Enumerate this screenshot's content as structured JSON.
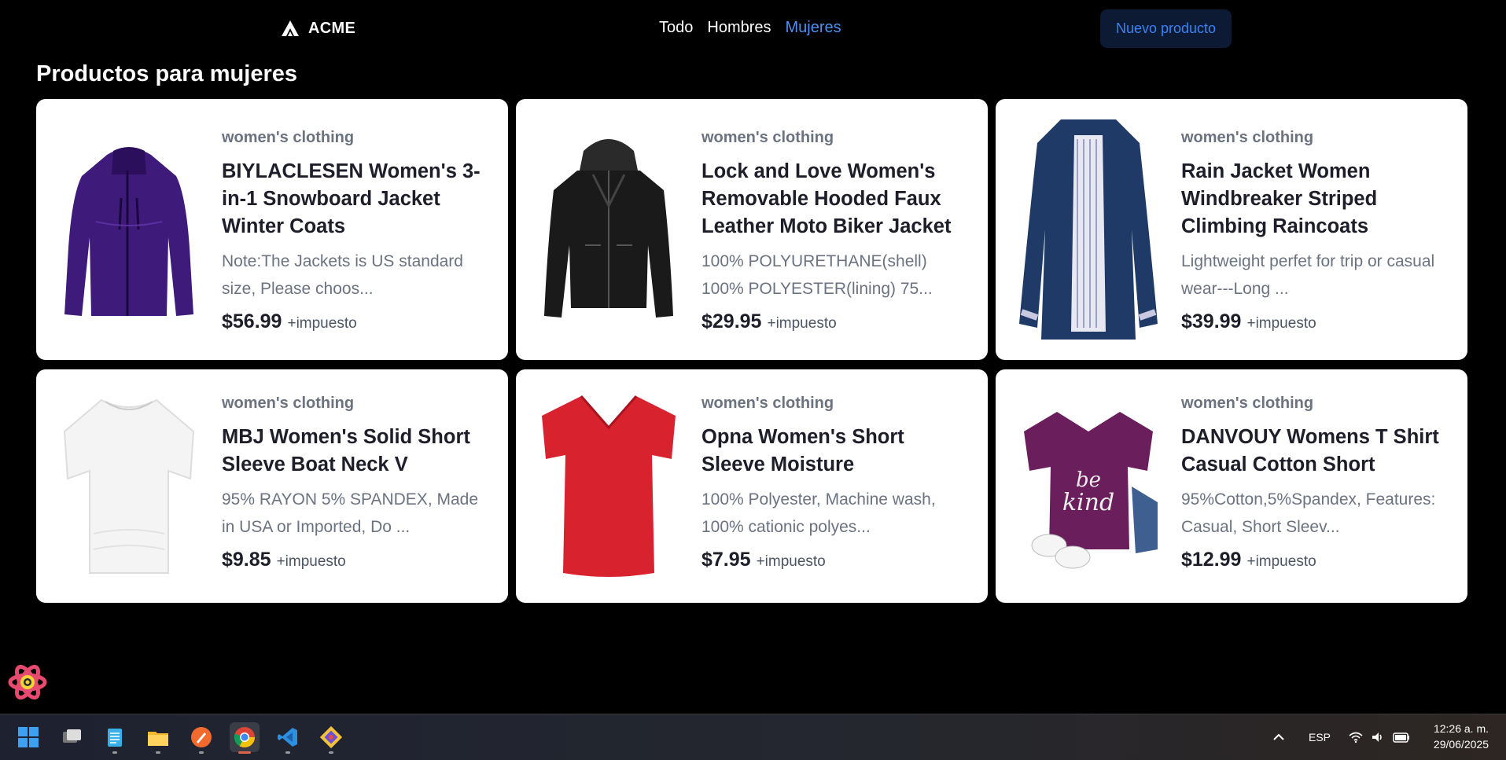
{
  "header": {
    "logo_text": "ACME",
    "nav": [
      {
        "label": "Todo",
        "active": false
      },
      {
        "label": "Hombres",
        "active": false
      },
      {
        "label": "Mujeres",
        "active": true
      }
    ],
    "new_product_label": "Nuevo producto"
  },
  "page_title": "Productos para mujeres",
  "products": [
    {
      "category": "women's clothing",
      "title": "BIYLACLESEN Women's 3-in-1 Snowboard Jacket Winter Coats",
      "description": "Note:The Jackets is US standard size, Please choos...",
      "price": "$56.99",
      "tax": "+impuesto",
      "image_icon": "purple-jacket-icon"
    },
    {
      "category": "women's clothing",
      "title": "Lock and Love Women's Removable Hooded Faux Leather Moto Biker Jacket",
      "description": "100% POLYURETHANE(shell) 100% POLYESTER(lining) 75...",
      "price": "$29.95",
      "tax": "+impuesto",
      "image_icon": "black-leather-jacket-icon"
    },
    {
      "category": "women's clothing",
      "title": "Rain Jacket Women Windbreaker Striped Climbing Raincoats",
      "description": "Lightweight perfet for trip or casual wear---Long ...",
      "price": "$39.99",
      "tax": "+impuesto",
      "image_icon": "navy-raincoat-icon"
    },
    {
      "category": "women's clothing",
      "title": "MBJ Women's Solid Short Sleeve Boat Neck V",
      "description": "95% RAYON 5% SPANDEX, Made in USA or Imported, Do ...",
      "price": "$9.85",
      "tax": "+impuesto",
      "image_icon": "white-top-icon"
    },
    {
      "category": "women's clothing",
      "title": "Opna Women's Short Sleeve Moisture",
      "description": "100% Polyester, Machine wash, 100% cationic polyes...",
      "price": "$7.95",
      "tax": "+impuesto",
      "image_icon": "red-tshirt-icon"
    },
    {
      "category": "women's clothing",
      "title": "DANVOUY Womens T Shirt Casual Cotton Short",
      "description": "95%Cotton,5%Spandex, Features: Casual, Short Sleev...",
      "price": "$12.99",
      "tax": "+impuesto",
      "image_icon": "purple-be-kind-tshirt-icon"
    }
  ],
  "taskbar": {
    "apps": [
      "start-icon",
      "task-view-icon",
      "notepad-icon",
      "file-explorer-icon",
      "pen-app-icon",
      "chrome-icon",
      "vscode-icon",
      "git-icon"
    ],
    "active_app": "chrome-icon",
    "language": "ESP",
    "time": "12:26 a. m.",
    "date": "29/06/2025"
  },
  "colors": {
    "accent": "#4f8ff7",
    "button_bg": "#0c1a33",
    "card_bg": "#ffffff",
    "active_indicator": "#e0644c"
  }
}
